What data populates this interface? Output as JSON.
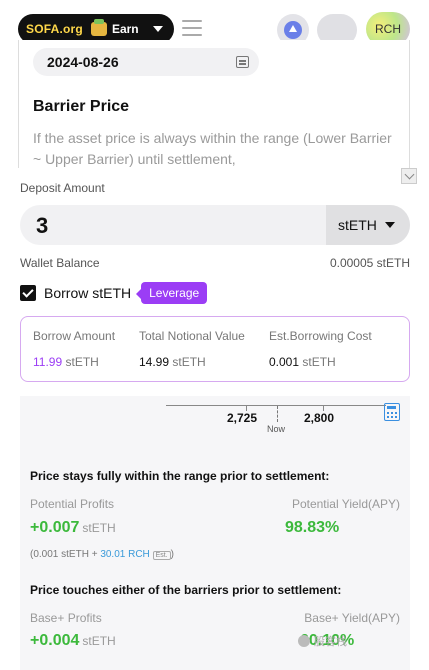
{
  "header": {
    "brand": "SOFA.org",
    "product": "Earn",
    "account_label": "RCH",
    "icons": [
      "menu-icon",
      "ethereum-icon",
      "chevron-down-icon"
    ]
  },
  "upper_card": {
    "date": "2024-08-26",
    "barrier_title": "Barrier Price",
    "barrier_description": "If the asset price is always within the range (Lower Barrier ~ Upper Barrier) until settlement,"
  },
  "deposit": {
    "label": "Deposit Amount",
    "value": "3",
    "token": "stETH",
    "wallet_label": "Wallet Balance",
    "wallet_value": "0.00005 stETH"
  },
  "borrow": {
    "checked": true,
    "label": "Borrow stETH",
    "badge": "Leverage",
    "columns": [
      {
        "label": "Borrow Amount",
        "value": "11.99",
        "unit": "stETH",
        "highlight": true
      },
      {
        "label": "Total Notional Value",
        "value": "14.99",
        "unit": "stETH",
        "highlight": false
      },
      {
        "label": "Est.Borrowing Cost",
        "value": "0.001",
        "unit": "stETH",
        "highlight": false
      }
    ]
  },
  "range": {
    "lower": "2,725",
    "upper": "2,800",
    "now_label": "Now"
  },
  "scenario_within": {
    "title": "Price stays fully within the range prior to settlement:",
    "left_label": "Potential Profits",
    "right_label": "Potential Yield(APY)",
    "profit": "+0.007",
    "profit_unit": "stETH",
    "yield": "98.83%",
    "note_prefix": "(0.001 stETH + ",
    "note_rch": "30.01 RCH",
    "note_badge": "Est.",
    "note_suffix": ")"
  },
  "scenario_touch": {
    "title": "Price touches either of the barriers prior to settlement:",
    "left_label": "Base+ Profits",
    "right_label": "Base+ Yield(APY)",
    "profit": "+0.004",
    "profit_unit": "stETH",
    "yield": "60.10%"
  },
  "watermark": "股客栈",
  "colors": {
    "accent_purple": "#9b3df5",
    "profit_green": "#3cb93c",
    "link_blue": "#3a9ad9"
  }
}
